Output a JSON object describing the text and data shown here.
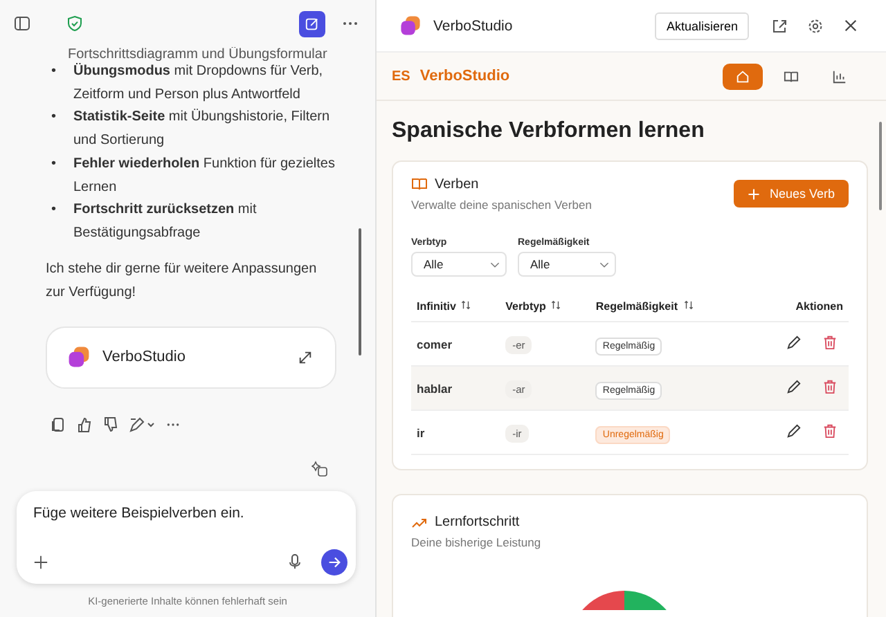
{
  "chat": {
    "cut_line": "Fortschrittsdiagramm und Übungsformular",
    "bullets": [
      {
        "marker": "•",
        "text": "**Übungsmodus** mit Dropdowns für Verb, Zeitform und Person plus Antwortfeld"
      },
      {
        "marker": "•",
        "text": "**Statistik-Seite** mit Übungshistorie, Filtern und Sortierung"
      },
      {
        "marker": "•",
        "text": "**Fehler wiederholen** Funktion für gezieltes Lernen"
      },
      {
        "marker": "•",
        "text": "**Fortschritt zurücksetzen** mit Bestätigungsabfrage"
      }
    ],
    "closing": "Ich stehe dir gerne für weitere Anpassungen zur Verfügung!",
    "app_card": {
      "title": "VerboStudio"
    },
    "input": {
      "value": "Füge weitere Beispielverben ein."
    },
    "disclaimer": "KI-generierte Inhalte können fehlerhaft sein"
  },
  "preview": {
    "title": "VerboStudio",
    "refresh_button": "Aktualisieren"
  },
  "app": {
    "logo_mark": "ES",
    "logo_name": "VerboStudio",
    "nav": [
      {
        "kind": "home",
        "selected": true
      },
      {
        "kind": "book",
        "selected": false
      },
      {
        "kind": "chart",
        "selected": false
      }
    ],
    "heading": "Spanische Verbformen lernen",
    "verbs_card": {
      "title": "Verben",
      "subtitle": "Verwalte deine spanischen Verben",
      "new_button": "Neues Verb",
      "filters": [
        {
          "label": "Verbtyp",
          "value": "Alle"
        },
        {
          "label": "Regelmäßigkeit",
          "value": "Alle"
        }
      ],
      "columns": [
        {
          "label": "Infinitiv",
          "sortable": true
        },
        {
          "label": "Verbtyp",
          "sortable": true
        },
        {
          "label": "Regelmäßigkeit",
          "sortable": true
        },
        {
          "label": "Aktionen",
          "sortable": false
        }
      ],
      "rows": [
        {
          "infinitive": "comer",
          "type": "-er",
          "regularity": "Regelmäßig",
          "irregular": false,
          "selected": false
        },
        {
          "infinitive": "hablar",
          "type": "-ar",
          "regularity": "Regelmäßig",
          "irregular": false,
          "selected": true
        },
        {
          "infinitive": "ir",
          "type": "-ir",
          "regularity": "Unregelmäßig",
          "irregular": true,
          "selected": false
        }
      ]
    },
    "progress_card": {
      "title": "Lernfortschritt",
      "subtitle": "Deine bisherige Leistung"
    }
  }
}
